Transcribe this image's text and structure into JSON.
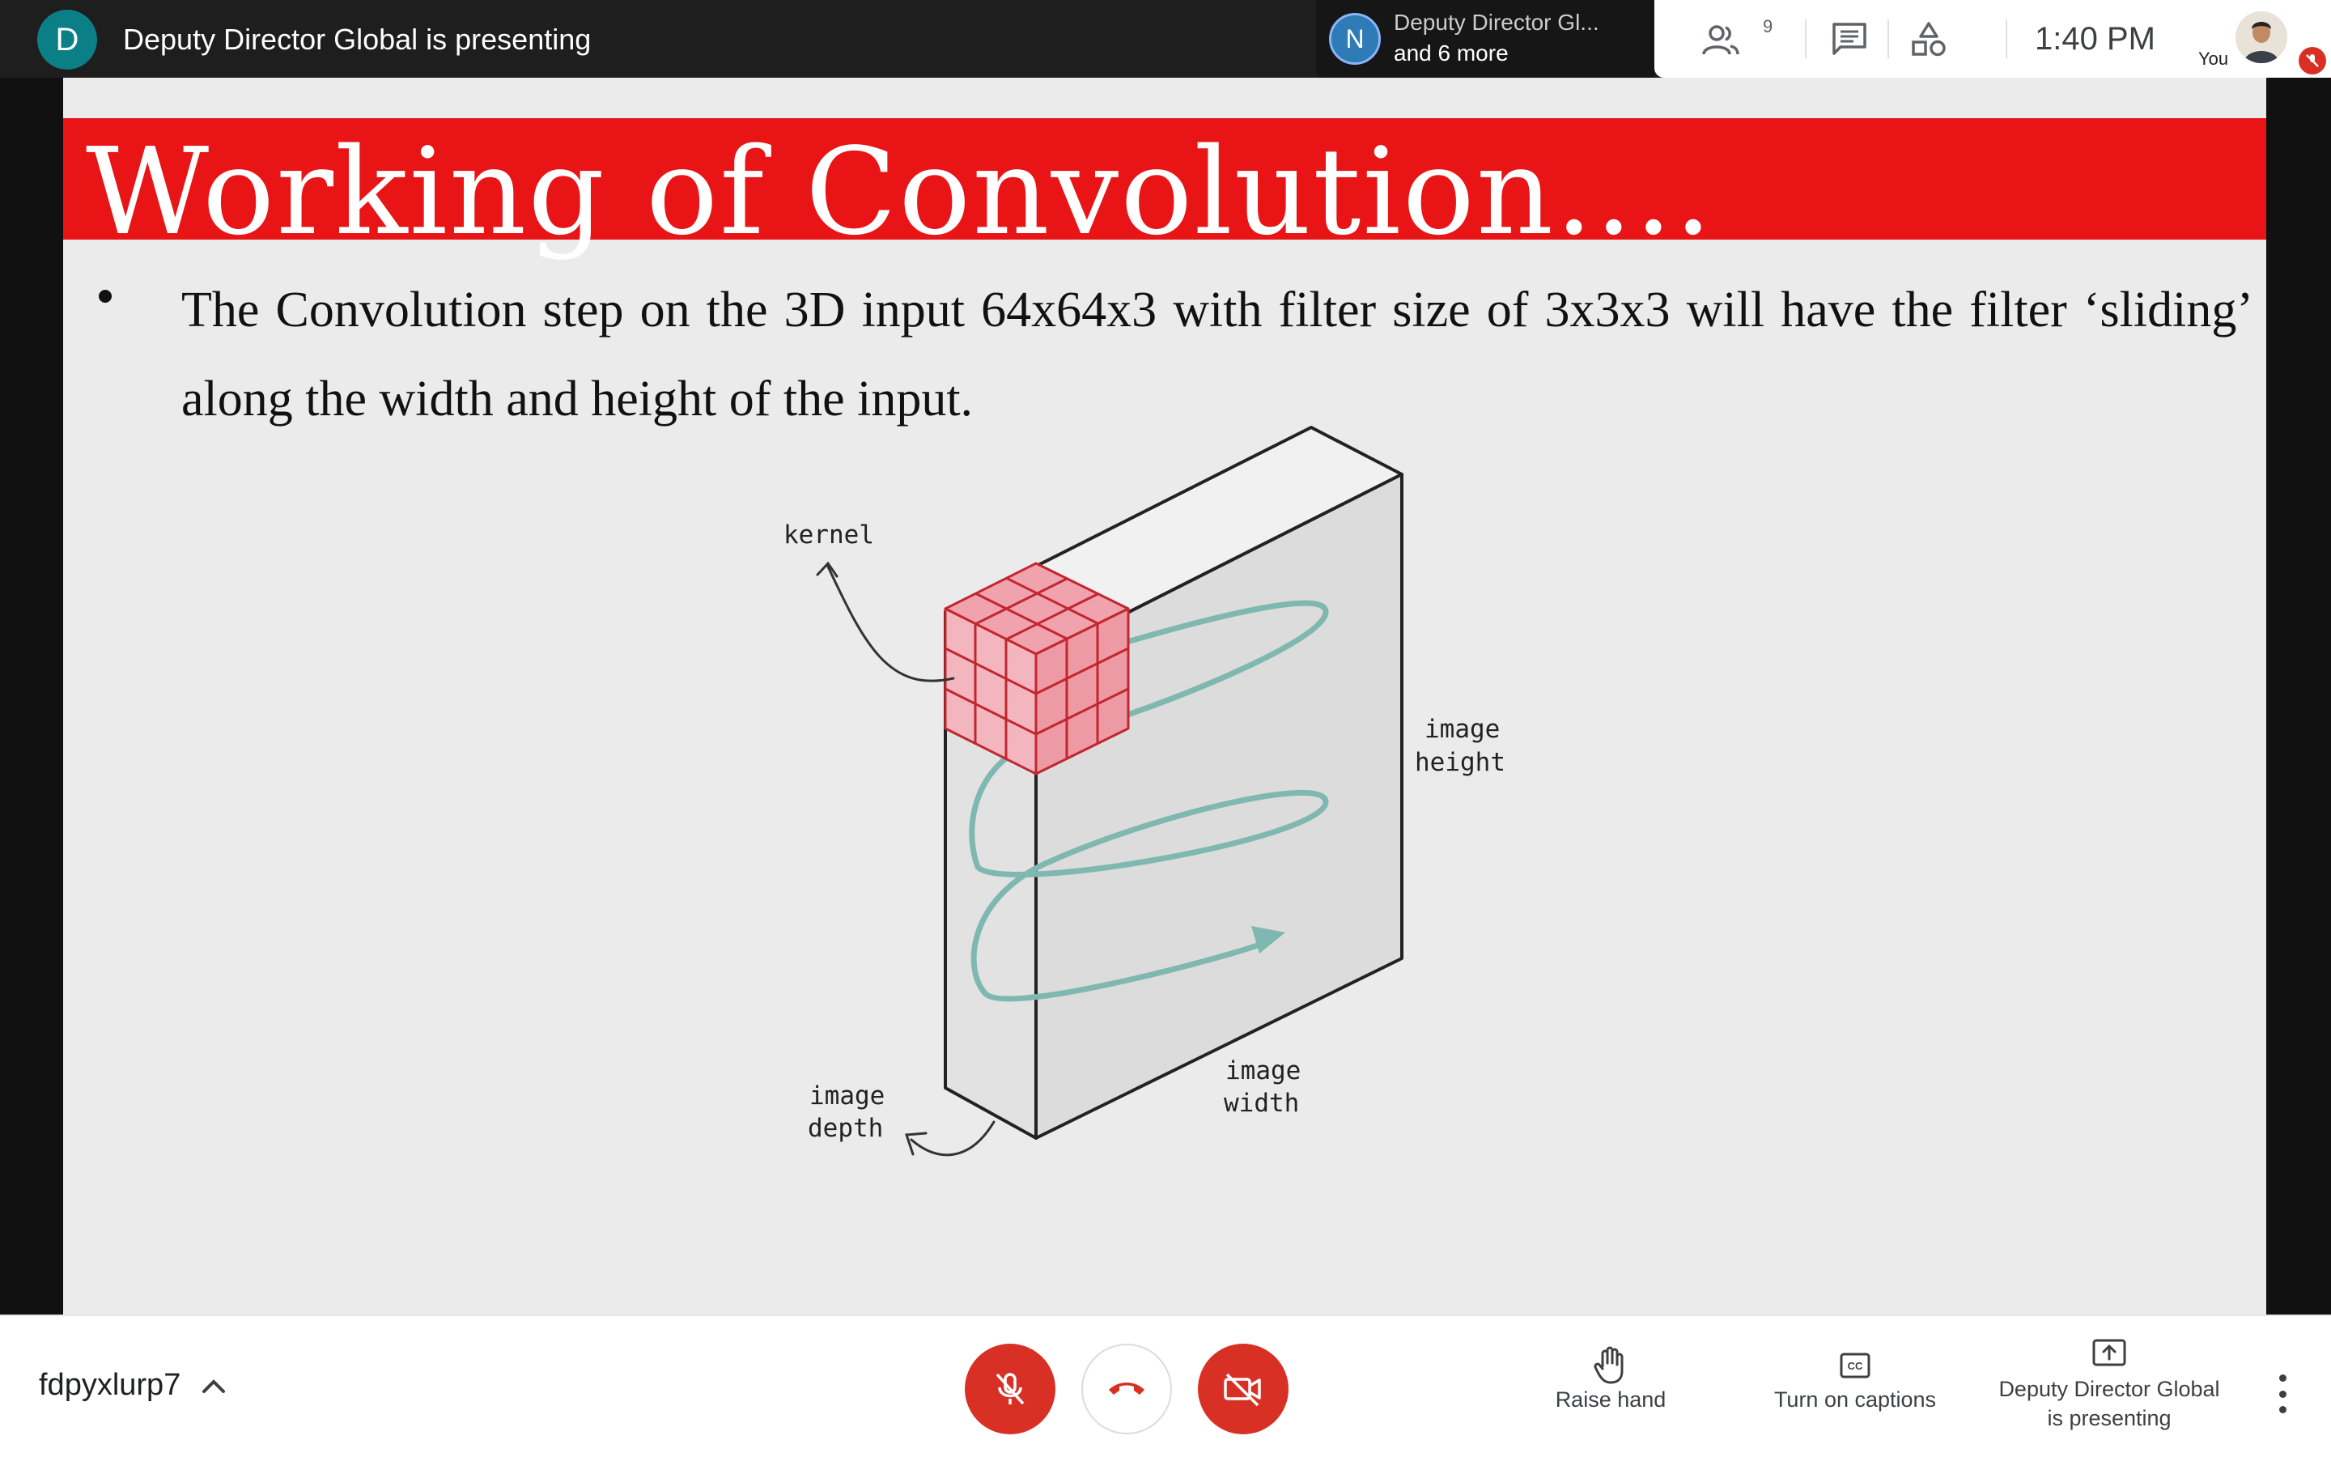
{
  "top_bar": {
    "presenter_initial": "D",
    "presenting_text": "Deputy Director Global is presenting",
    "participant_chip": {
      "initial": "N",
      "name": "Deputy Director Gl...",
      "more": "and 6 more"
    },
    "people_count": "9",
    "clock": "1:40 PM",
    "you_label": "You",
    "icons": [
      "people-icon",
      "chat-icon",
      "activities-icon",
      "mic-off-icon"
    ]
  },
  "slide": {
    "title": "Working of Convolution....",
    "bullet": "The Convolution step on the 3D input 64x64x3 with filter size of 3x3x3 will have the filter ‘sliding’ along the width and height of the input.",
    "diagram_labels": {
      "kernel": "kernel",
      "image_height_1": "image",
      "image_height_2": "height",
      "image_width_1": "image",
      "image_width_2": "width",
      "image_depth_1": "image",
      "image_depth_2": "depth"
    },
    "colors": {
      "title_band": "#e81416",
      "kernel": "#e5404d",
      "spiral": "#7fb8b0"
    }
  },
  "bottom_bar": {
    "meeting_code": "fdpyxlurp7",
    "controls": {
      "mic": "mic-off-icon",
      "end_call": "end-call-icon",
      "camera": "camera-off-icon"
    },
    "raise_hand": "Raise hand",
    "captions": "Turn on captions",
    "present_1": "Deputy Director Global",
    "present_2": "is presenting"
  }
}
